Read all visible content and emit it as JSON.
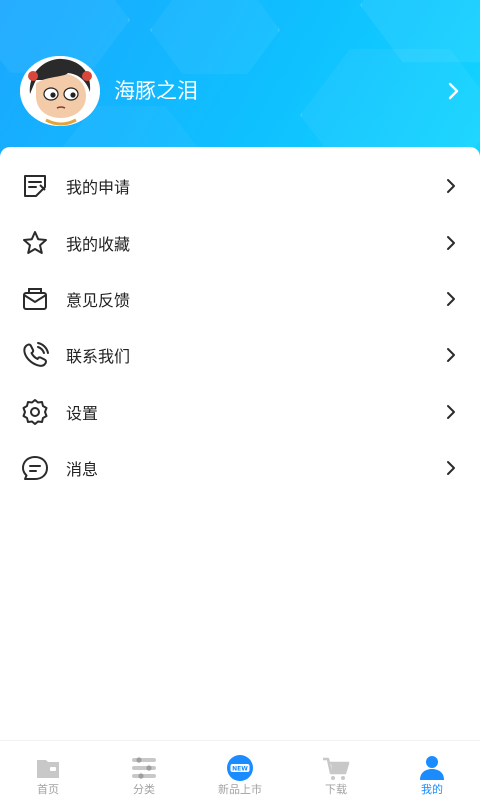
{
  "profile": {
    "username": "海豚之泪"
  },
  "menu": [
    {
      "label": "我的申请",
      "icon": "edit-note-icon"
    },
    {
      "label": "我的收藏",
      "icon": "star-icon"
    },
    {
      "label": "意见反馈",
      "icon": "feedback-envelope-icon"
    },
    {
      "label": "联系我们",
      "icon": "phone-icon"
    },
    {
      "label": "设置",
      "icon": "gear-icon"
    },
    {
      "label": "消息",
      "icon": "message-bubble-icon"
    }
  ],
  "nav": [
    {
      "label": "首页",
      "icon": "home-icon",
      "active": false
    },
    {
      "label": "分类",
      "icon": "category-icon",
      "active": false
    },
    {
      "label": "新品上市",
      "icon": "new-badge-icon",
      "active": false
    },
    {
      "label": "下载",
      "icon": "cart-icon",
      "active": false
    },
    {
      "label": "我的",
      "icon": "user-icon",
      "active": true
    }
  ],
  "colors": {
    "header_start": "#1aa7ff",
    "header_end": "#12d6ff",
    "active": "#1a8cff",
    "inactive": "#a3a3a3"
  }
}
